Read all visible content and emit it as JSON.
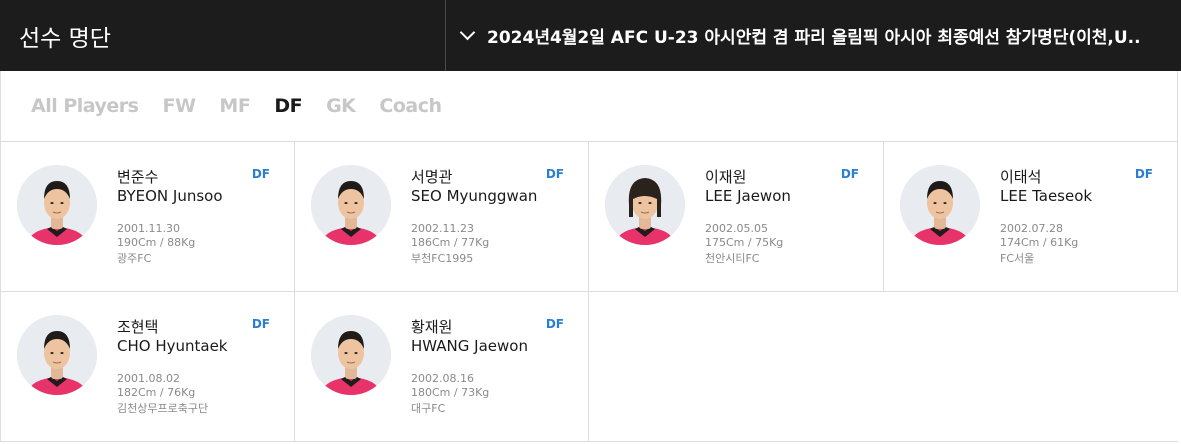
{
  "header": {
    "title": "선수 명단",
    "selected_roster": "2024년4월2일 AFC U-23 아시안컵 겸 파리 올림픽 아시아 최종예선 참가명단(이천,U.."
  },
  "tabs": [
    {
      "label": "All Players",
      "active": false
    },
    {
      "label": "FW",
      "active": false
    },
    {
      "label": "MF",
      "active": false
    },
    {
      "label": "DF",
      "active": true
    },
    {
      "label": "GK",
      "active": false
    },
    {
      "label": "Coach",
      "active": false
    }
  ],
  "players": [
    {
      "korean_name": "변준수",
      "english_name": "BYEON Junsoo",
      "position": "DF",
      "birth": "2001.11.30",
      "physique": "190Cm / 88Kg",
      "club": "광주FC"
    },
    {
      "korean_name": "서명관",
      "english_name": "SEO Myunggwan",
      "position": "DF",
      "birth": "2002.11.23",
      "physique": "186Cm / 77Kg",
      "club": "부천FC1995"
    },
    {
      "korean_name": "이재원",
      "english_name": "LEE Jaewon",
      "position": "DF",
      "birth": "2002.05.05",
      "physique": "175Cm / 75Kg",
      "club": "천안시티FC"
    },
    {
      "korean_name": "이태석",
      "english_name": "LEE Taeseok",
      "position": "DF",
      "birth": "2002.07.28",
      "physique": "174Cm / 61Kg",
      "club": "FC서울"
    },
    {
      "korean_name": "조현택",
      "english_name": "CHO Hyuntaek",
      "position": "DF",
      "birth": "2001.08.02",
      "physique": "182Cm / 76Kg",
      "club": "김천상무프로축구단"
    },
    {
      "korean_name": "황재원",
      "english_name": "HWANG Jaewon",
      "position": "DF",
      "birth": "2002.08.16",
      "physique": "180Cm / 73Kg",
      "club": "대구FC"
    }
  ],
  "colors": {
    "header_bg": "#1c1c1c",
    "active_tab": "#1a1a1a",
    "inactive_tab": "#c7c7c7",
    "position_badge": "#2a7fd4",
    "jersey": "#e8336a"
  },
  "icons": {
    "dropdown": "chevron-down-icon",
    "player_photo": "player-photo"
  }
}
